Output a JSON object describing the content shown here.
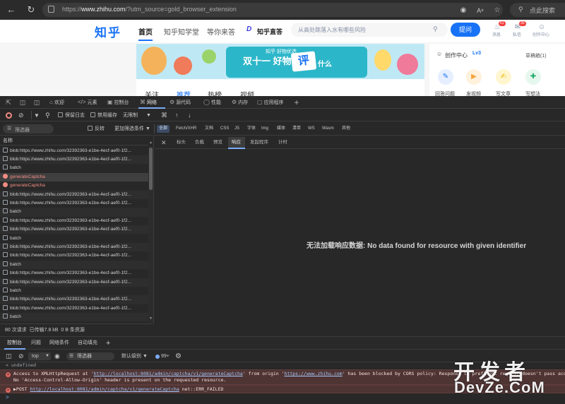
{
  "browser": {
    "url_prefix": "https://",
    "url_host": "www.zhihu.com",
    "url_rest": "/?utm_source=gold_browser_extension",
    "search_label": "点此搜索"
  },
  "zhihu": {
    "logo": "知乎",
    "nav": [
      "首页",
      "知乎知学堂",
      "等你来答",
      "知乎直答"
    ],
    "search_placeholder": "从高处跳落入水有哪些风险",
    "ask_label": "提问",
    "top_icons": [
      {
        "label": "消息",
        "badge": "61"
      },
      {
        "label": "私信",
        "badge": "30"
      },
      {
        "label": "创作中心",
        "badge": ""
      }
    ],
    "banner": {
      "sub": "知乎 好物优选",
      "main": "双十一 好物",
      "sticker": "评",
      "end": "什么"
    },
    "feed_tabs": [
      "关注",
      "推荐",
      "热榜",
      "视频"
    ],
    "creator": {
      "title": "创作中心",
      "level": "Lv3",
      "drafts": "草稿箱(1)",
      "actions": [
        "回答问题",
        "发视频",
        "写文章",
        "写想法"
      ]
    }
  },
  "devtools": {
    "tabs": [
      "欢迎",
      "元素",
      "控制台",
      "网络",
      "源代码",
      "性能",
      "内存",
      "应用程序"
    ],
    "toolbar": {
      "preserve_log": "保留日志",
      "disable_cache": "禁用缓存",
      "throttle": "无限制"
    },
    "filter": {
      "placeholder": "筛选器",
      "invert": "反转",
      "more_filters": "更加筛选条件",
      "types": [
        "全部",
        "Fetch/XHR",
        "文档",
        "CSS",
        "JS",
        "字体",
        "Img",
        "媒体",
        "清单",
        "WS",
        "Wasm",
        "其他"
      ]
    },
    "list_header": "名称",
    "requests": [
      {
        "name": "blob:https://www.zhihu.com/32392363-e1be-4ecf-aef0-1f2...",
        "kind": "blob"
      },
      {
        "name": "blob:https://www.zhihu.com/32392363-e1be-4ecf-aef0-1f2...",
        "kind": "blob"
      },
      {
        "name": "batch",
        "kind": "doc"
      },
      {
        "name": "generateCaptcha",
        "kind": "error"
      },
      {
        "name": "generateCaptcha",
        "kind": "error"
      },
      {
        "name": "blob:https://www.zhihu.com/32392363-e1be-4ecf-aef0-1f2...",
        "kind": "blob"
      },
      {
        "name": "blob:https://www.zhihu.com/32392363-e1be-4ecf-aef0-1f2...",
        "kind": "blob"
      },
      {
        "name": "batch",
        "kind": "doc"
      },
      {
        "name": "blob:https://www.zhihu.com/32392363-e1be-4ecf-aef0-1f2...",
        "kind": "blob"
      },
      {
        "name": "blob:https://www.zhihu.com/32392363-e1be-4ecf-aef0-1f2...",
        "kind": "blob"
      },
      {
        "name": "batch",
        "kind": "doc"
      },
      {
        "name": "blob:https://www.zhihu.com/32392363-e1be-4ecf-aef0-1f2...",
        "kind": "blob"
      },
      {
        "name": "blob:https://www.zhihu.com/32392363-e1be-4ecf-aef0-1f2...",
        "kind": "blob"
      },
      {
        "name": "batch",
        "kind": "doc"
      },
      {
        "name": "blob:https://www.zhihu.com/32392363-e1be-4ecf-aef0-1f2...",
        "kind": "blob"
      },
      {
        "name": "blob:https://www.zhihu.com/32392363-e1be-4ecf-aef0-1f2...",
        "kind": "blob"
      },
      {
        "name": "batch",
        "kind": "doc"
      },
      {
        "name": "blob:https://www.zhihu.com/32392363-e1be-4ecf-aef0-1f2...",
        "kind": "blob"
      },
      {
        "name": "blob:https://www.zhihu.com/32392363-e1be-4ecf-aef0-1f2...",
        "kind": "blob"
      },
      {
        "name": "batch",
        "kind": "doc"
      }
    ],
    "status": {
      "requests": "80 次请求",
      "transferred": "已传输7.8 kB",
      "resources": "0 B 条资源"
    },
    "detail_tabs": [
      "标头",
      "负载",
      "预览",
      "响应",
      "发起程序",
      "计时"
    ],
    "detail_message": "无法加载响应数据: No data found for resource with given identifier",
    "drawer_tabs": [
      "控制台",
      "问题",
      "网络条件",
      "自动填充"
    ],
    "console_toolbar": {
      "context": "top",
      "filter": "筛选器",
      "level": "默认级别",
      "count": "99+"
    },
    "console": {
      "undefined_line": "< undefined",
      "cors_pre": "Access to XMLHttpRequest at '",
      "cors_url": "http://localhost:8081/admin/captcha/v1/generateCaptcha",
      "cors_mid": "' from origin '",
      "cors_origin": "https://www.zhihu.com",
      "cors_post": "' has been blocked by CORS policy: Response to preflight request doesn't pass access control check:",
      "cors_line2": "No 'Access-Control-Allow-Origin' header is present on the requested resource.",
      "post_pre": "▶POST ",
      "post_url": "http://localhost:8081/admin/captcha/v1/generateCaptcha",
      "post_post": " net::ERR_FAILED",
      "prompt": ">"
    }
  },
  "watermark": {
    "top": "开发者",
    "bottom": "DevZe.CoM"
  },
  "colors": {
    "zhihu_blue": "#1772f6",
    "devtools_accent": "#7cacf8",
    "error_bg": "#4e3534"
  }
}
